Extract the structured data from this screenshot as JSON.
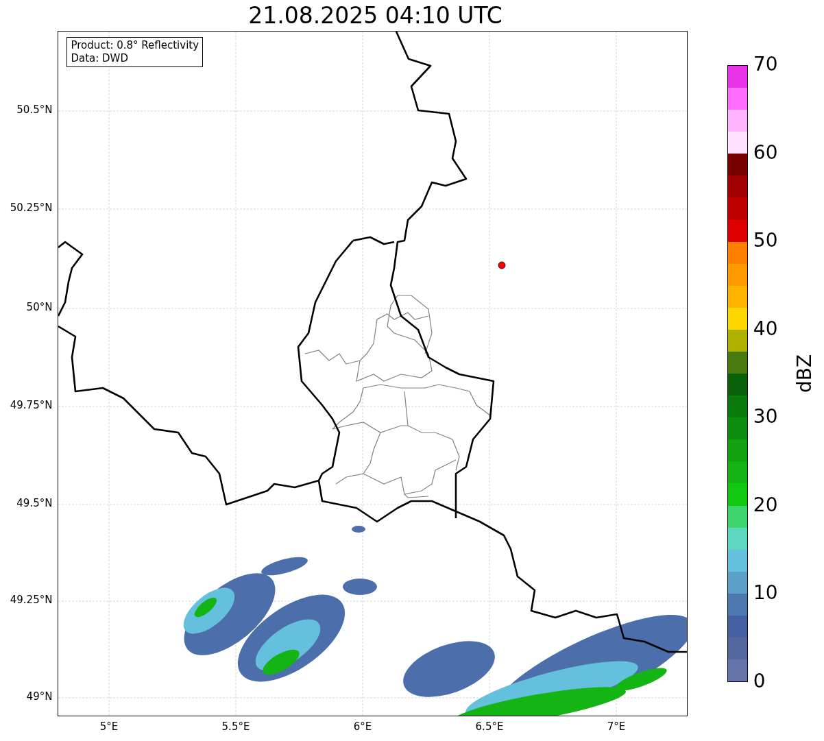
{
  "title": "21.08.2025 04:10 UTC",
  "info_box": [
    "Product: 0.8° Reflectivity",
    "Data: DWD"
  ],
  "y_ticks": [
    "50.5°N",
    "50.25°N",
    "50°N",
    "49.75°N",
    "49.5°N",
    "49.25°N",
    "49°N"
  ],
  "x_ticks": [
    "5°E",
    "5.5°E",
    "6°E",
    "6.5°E",
    "7°E"
  ],
  "colorbar": {
    "label": "dBZ",
    "ticks": [
      "70",
      "60",
      "50",
      "40",
      "30",
      "20",
      "10",
      "0"
    ],
    "segments": [
      {
        "color": "#e832e8"
      },
      {
        "color": "#ff6eff"
      },
      {
        "color": "#ffb4ff"
      },
      {
        "color": "#ffe0ff"
      },
      {
        "color": "#780000"
      },
      {
        "color": "#a00000"
      },
      {
        "color": "#c00000"
      },
      {
        "color": "#e00000"
      },
      {
        "color": "#ff7f00"
      },
      {
        "color": "#ff9a00"
      },
      {
        "color": "#ffb400"
      },
      {
        "color": "#ffd700"
      },
      {
        "color": "#b0b000"
      },
      {
        "color": "#487a10"
      },
      {
        "color": "#086008"
      },
      {
        "color": "#0a7a0a"
      },
      {
        "color": "#0c8c0c"
      },
      {
        "color": "#10a010"
      },
      {
        "color": "#14b414"
      },
      {
        "color": "#10c810"
      },
      {
        "color": "#3ed46e"
      },
      {
        "color": "#5ed8c0"
      },
      {
        "color": "#64c0dc"
      },
      {
        "color": "#5aa0c8"
      },
      {
        "color": "#4c7ab0"
      },
      {
        "color": "#4460a0"
      },
      {
        "color": "#5468a0"
      },
      {
        "color": "#6474a8"
      }
    ]
  }
}
